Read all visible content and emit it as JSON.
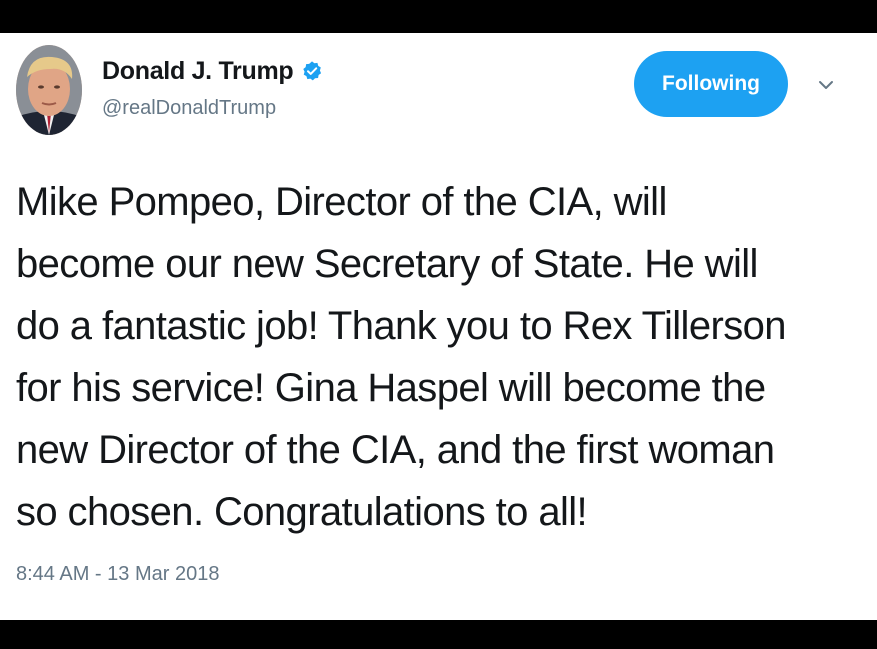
{
  "tweet": {
    "author": {
      "display_name": "Donald J. Trump",
      "handle": "@realDonaldTrump",
      "verified": true,
      "avatar_icon": "profile-photo"
    },
    "follow_button_label": "Following",
    "menu_icon": "chevron-down-icon",
    "text_lines": [
      "Mike Pompeo, Director of the CIA, will",
      "become our new Secretary of State. He will",
      "do a fantastic job! Thank you to Rex Tillerson",
      "for his service! Gina Haspel will become the",
      "new Director of the CIA, and the first woman",
      "so chosen. Congratulations to all!"
    ],
    "timestamp": "8:44 AM - 13 Mar 2018"
  },
  "colors": {
    "accent": "#1da1f2",
    "text_primary": "#14171a",
    "text_secondary": "#657786",
    "frame": "#000000",
    "card_background": "#ffffff"
  }
}
